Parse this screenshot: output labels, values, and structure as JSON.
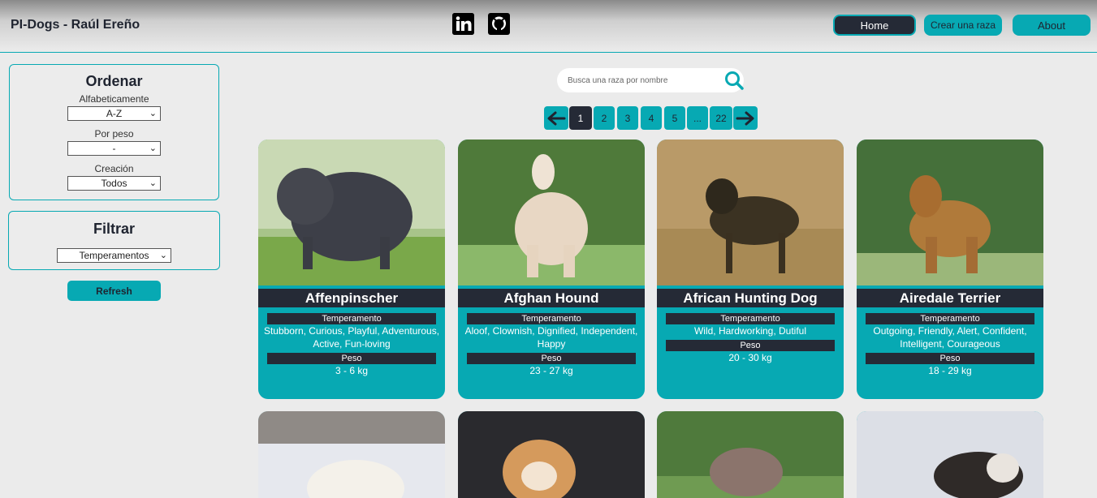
{
  "header": {
    "brand": "PI-Dogs - Raúl Ereño",
    "nav": {
      "home": "Home",
      "crear": "Crear una raza",
      "about": "About"
    }
  },
  "sidebar": {
    "order": {
      "title": "Ordenar",
      "alpha_label": "Alfabeticamente",
      "alpha_value": "A-Z",
      "weight_label": "Por peso",
      "weight_value": "-",
      "creation_label": "Creación",
      "creation_value": "Todos"
    },
    "filter": {
      "title": "Filtrar",
      "temper_value": "Temperamentos"
    },
    "refresh": "Refresh"
  },
  "search": {
    "placeholder": "Busca una raza por nombre"
  },
  "pagination": {
    "pages": [
      "1",
      "2",
      "3",
      "4",
      "5",
      "...",
      "22"
    ],
    "current": "1"
  },
  "cards": [
    {
      "name": "Affenpinscher",
      "temper_label": "Temperamento",
      "temper": "Stubborn, Curious, Playful, Adventurous, Active, Fun-loving",
      "weight_label": "Peso",
      "weight": "3 - 6 kg"
    },
    {
      "name": "Afghan Hound",
      "temper_label": "Temperamento",
      "temper": "Aloof, Clownish, Dignified, Independent, Happy",
      "weight_label": "Peso",
      "weight": "23 - 27 kg"
    },
    {
      "name": "African Hunting Dog",
      "temper_label": "Temperamento",
      "temper": "Wild, Hardworking, Dutiful",
      "weight_label": "Peso",
      "weight": "20 - 30 kg"
    },
    {
      "name": "Airedale Terrier",
      "temper_label": "Temperamento",
      "temper": "Outgoing, Friendly, Alert, Confident, Intelligent, Courageous",
      "weight_label": "Peso",
      "weight": "18 - 29 kg"
    }
  ],
  "colors": {
    "accent": "#07a9b3",
    "dark": "#252a36"
  }
}
